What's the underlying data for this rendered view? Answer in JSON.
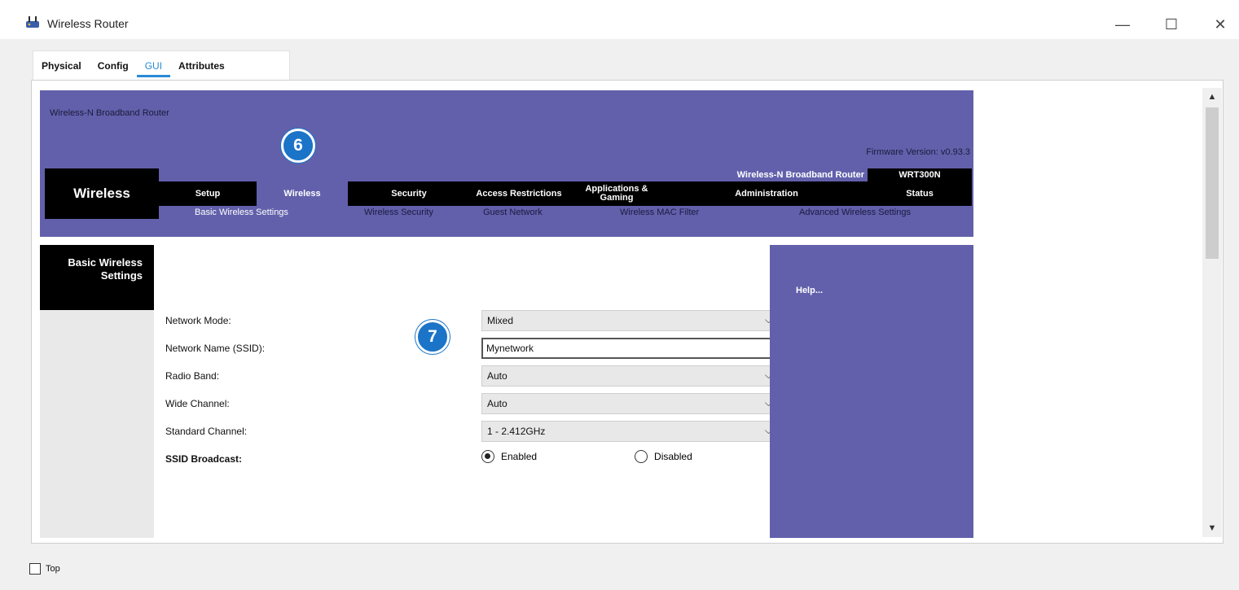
{
  "window": {
    "title": "Wireless Router",
    "minimize": "—",
    "maximize": "☐",
    "close": "✕"
  },
  "tabs": [
    {
      "label": "Physical"
    },
    {
      "label": "Config"
    },
    {
      "label": "GUI"
    },
    {
      "label": "Attributes"
    }
  ],
  "router": {
    "banner_title": "Wireless-N Broadband Router",
    "firmware": "Firmware Version: v0.93.3",
    "section": "Wireless",
    "product_name": "Wireless-N Broadband Router",
    "model": "WRT300N",
    "menu": [
      {
        "label": "Setup"
      },
      {
        "label": "Wireless"
      },
      {
        "label": "Security"
      },
      {
        "label": "Access Restrictions"
      },
      {
        "label": "Applications & Gaming"
      },
      {
        "label": "Administration"
      },
      {
        "label": "Status"
      }
    ],
    "submenu": [
      {
        "label": "Basic Wireless Settings"
      },
      {
        "label": "Wireless Security"
      },
      {
        "label": "Guest Network"
      },
      {
        "label": "Wireless MAC Filter"
      },
      {
        "label": "Advanced Wireless Settings"
      }
    ],
    "side_title": "Basic Wireless Settings",
    "help": "Help...",
    "form": {
      "network_mode": {
        "label": "Network Mode:",
        "value": "Mixed"
      },
      "ssid": {
        "label": "Network Name (SSID):",
        "value": "Mynetwork"
      },
      "radio_band": {
        "label": "Radio Band:",
        "value": "Auto"
      },
      "wide_channel": {
        "label": "Wide Channel:",
        "value": "Auto"
      },
      "standard_channel": {
        "label": "Standard Channel:",
        "value": "1 - 2.412GHz"
      },
      "ssid_broadcast": {
        "label": "SSID Broadcast:",
        "enabled": "Enabled",
        "disabled": "Disabled",
        "selected": "Enabled"
      }
    }
  },
  "callouts": {
    "step6": "6",
    "step7": "7"
  },
  "bottom": {
    "top_label": "Top"
  },
  "colors": {
    "router_purple": "#6260ab",
    "accent_blue": "#2a8bd4",
    "callout_blue": "#1b74c7"
  }
}
